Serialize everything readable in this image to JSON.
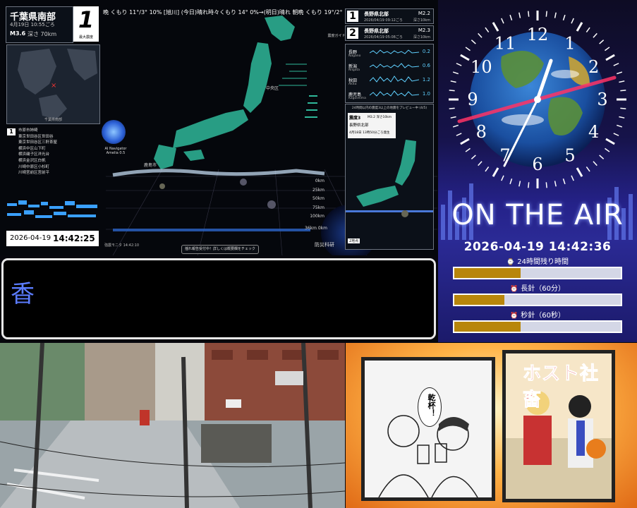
{
  "earthquake": {
    "location": "千葉県南部",
    "datetime": "4月19日 10:55ごろ",
    "magnitude": "M3.6",
    "depth": "深さ 70km",
    "max_intensity": "1",
    "max_intensity_label": "最大震度",
    "ticker": "晩 くもり 11°/3° 10% [旭川] (今日)晴れ時々くもり 14° 0%→(明日)晴れ 朝晩 くもり 19°/2°",
    "mini_map_caption": "千葉県南部",
    "area_badge": "1",
    "areas": [
      "市原市姉崎",
      "東京世田谷区世田谷",
      "東京世田谷区三軒茶屋",
      "横浜中区山下町",
      "横浜磯子区洋光台",
      "横浜金沢区白帆",
      "川崎中原区小杉町",
      "川崎宮前区宮前平"
    ],
    "ai_label": "AI Navigator Amelia 0.5",
    "legend_label": "震度ガイド",
    "city_a": "鹿島市",
    "city_b": "中央区",
    "scale": [
      "0km",
      "25km",
      "50km",
      "75km",
      "100km"
    ],
    "distance": "36km 0km",
    "map_button": "揺れ報告受付中！詳しくは概要欄をチェック",
    "disaster_label": "防災科研",
    "realtime_label": "強震モニタ 14:42:10",
    "clock_date": "2026-04-19",
    "clock_time": "14:42:25",
    "recent": [
      {
        "num": "1",
        "name": "長野県北部",
        "mag": "M2.2",
        "date": "2026/04/19 09:12ごろ",
        "depth": "深さ10km"
      },
      {
        "num": "2",
        "name": "長野県北部",
        "mag": "M2.3",
        "date": "2026/04/19 05:08ごろ",
        "depth": "深さ10km"
      }
    ],
    "waves": [
      {
        "name": "長野",
        "sub": "Nagano",
        "val": "0.2"
      },
      {
        "name": "新潟",
        "sub": "Niigata",
        "val": "0.6"
      },
      {
        "name": "秋田",
        "sub": "Akita",
        "val": "1.2"
      },
      {
        "name": "鹿児島",
        "sub": "Kagoshima",
        "val": "1.0"
      }
    ],
    "preview_title": "24時間以内の震度3以上の地震をプレビュー中 (4/5)",
    "preview_intensity": "震度3",
    "preview_mag": "M3.2 深さ10km",
    "preview_location": "長野県北部",
    "preview_time": "4月18日 13時50分ごろ発生",
    "preview_corner": "2地点"
  },
  "text_band": {
    "char": "香"
  },
  "on_air": {
    "title": "ON THE AIR",
    "datetime": "2026-04-19 14:42:36",
    "clock_numbers": [
      "12",
      "1",
      "2",
      "3",
      "4",
      "5",
      "6",
      "7",
      "8",
      "9",
      "10",
      "11"
    ],
    "bars": [
      {
        "icon": "⌚",
        "label": "24時間残り時間",
        "progress": 0.4
      },
      {
        "icon": "⏰",
        "label": "長針（60分）",
        "progress": 0.3
      },
      {
        "icon": "⏰",
        "label": "秒針（60秒）",
        "progress": 0.4
      }
    ],
    "accent": "#b8860b"
  },
  "manga": {
    "title": "ホスト社畜",
    "bubble": "乾杯！"
  }
}
